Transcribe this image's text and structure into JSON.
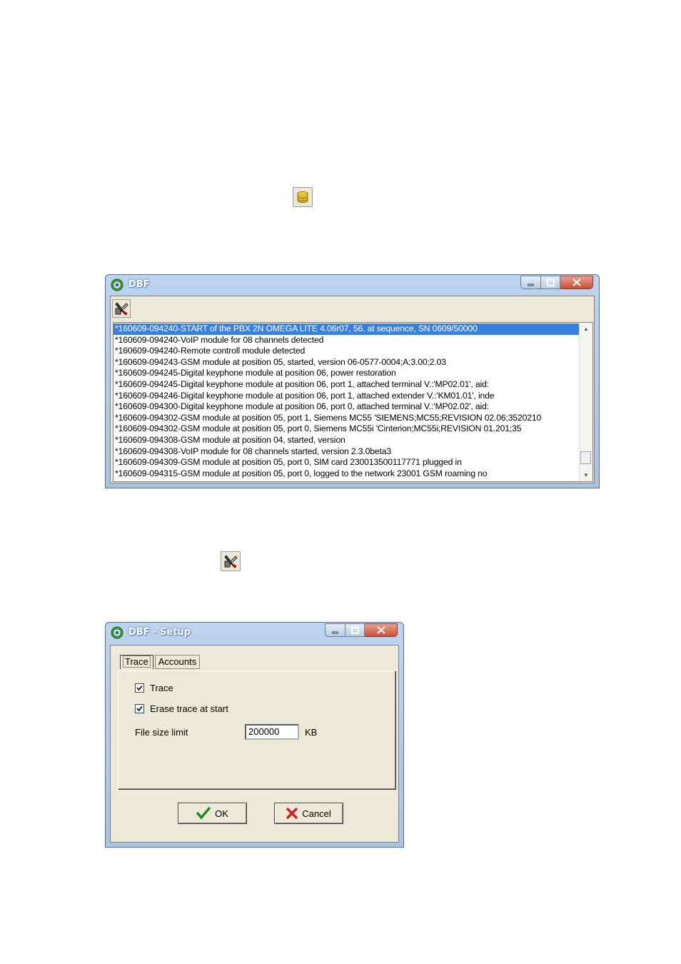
{
  "icons": {
    "database_icon": "database-icon",
    "setup_icon": "setup-tools-icon"
  },
  "dbf_window": {
    "title": "DBF",
    "log_lines": [
      "*160609-094240-START of the PBX 2N OMEGA LITE  4.06r07,   56. at sequence, SN 0609/50000",
      "*160609-094240-VoIP module for 08 channels detected",
      "*160609-094240-Remote controll module detected",
      "*160609-094243-GSM module at position 05, started, version 06-0577-0004;A;3.00;2.03",
      "*160609-094245-Digital keyphone module at position 06, power restoration",
      "*160609-094245-Digital keyphone module at position 06, port 1, attached terminal V.:'MP02.01', aid:",
      "*160609-094246-Digital keyphone module at position 06, port 1, attached extender V.:'KM01.01', inde",
      "*160609-094300-Digital keyphone module at position 06, port 0, attached terminal V.:'MP02.02', aid:",
      "*160609-094302-GSM module at position 05, port 1, Siemens MC55 'SIEMENS;MC55;REVISION 02.06;3520210",
      "*160609-094302-GSM module at position 05, port 0, Siemens MC55i 'Cinterion;MC55i;REVISION 01.201;35",
      "*160609-094308-GSM module at position 04, started, version",
      "*160609-094308-VoIP module for 08 channels started, version 2.3.0beta3",
      "*160609-094309-GSM module at position 05, port 0, SIM card 230013500117771 plugged in",
      "*160609-094315-GSM module at position 05, port 0, logged to the network  23001 GSM roaming no"
    ]
  },
  "setup_window": {
    "title": "DBF - Setup",
    "tabs": [
      "Trace",
      "Accounts"
    ],
    "trace_label": "Trace",
    "trace_checked": true,
    "erase_label": "Erase trace at start",
    "erase_checked": true,
    "file_size_label": "File size limit",
    "file_size_value": "200000",
    "file_size_unit": "KB",
    "ok_label": "OK",
    "cancel_label": "Cancel"
  }
}
